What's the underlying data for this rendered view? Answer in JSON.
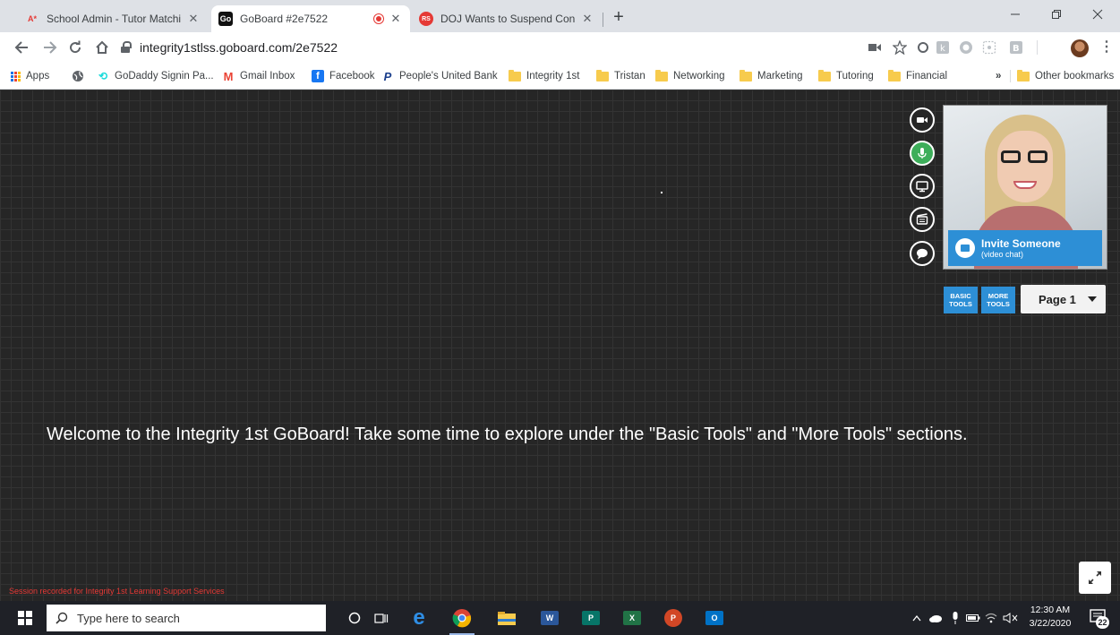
{
  "browser": {
    "tabs": [
      {
        "label": "School Admin - Tutor Matching S",
        "favicon": "A*",
        "close": "✕"
      },
      {
        "label": "GoBoard  #2e7522",
        "favicon": "Go",
        "close": "✕",
        "active": true
      },
      {
        "label": "DOJ Wants to Suspend Constituti",
        "favicon": "RS",
        "close": "✕"
      }
    ],
    "new_tab": "+",
    "url": "integrity1stlss.goboard.com/2e7522",
    "bookmarks": [
      {
        "label": "Apps",
        "type": "apps"
      },
      {
        "label": "",
        "type": "globe"
      },
      {
        "label": "GoDaddy Signin Pa...",
        "type": "site",
        "icon": "⟲"
      },
      {
        "label": "Gmail Inbox",
        "type": "site",
        "icon": "M"
      },
      {
        "label": "Facebook",
        "type": "site",
        "icon": "f"
      },
      {
        "label": "People's United Bank",
        "type": "site",
        "icon": "P"
      },
      {
        "label": "Integrity 1st",
        "type": "folder"
      },
      {
        "label": "Tristan",
        "type": "folder"
      },
      {
        "label": "Networking",
        "type": "folder"
      },
      {
        "label": "Marketing",
        "type": "folder"
      },
      {
        "label": "Tutoring",
        "type": "folder"
      },
      {
        "label": "Financial",
        "type": "folder"
      }
    ],
    "more_bookmarks": "»",
    "other_bookmarks": "Other bookmarks"
  },
  "board": {
    "invite_title": "Invite Someone",
    "invite_subtitle": "(video chat)",
    "basic_tools": [
      "BASIC",
      "TOOLS"
    ],
    "more_tools": [
      "MORE",
      "TOOLS"
    ],
    "page_selector": "Page 1",
    "welcome_text": "Welcome to the Integrity 1st GoBoard!  Take some time to explore under the \"Basic Tools\" and \"More Tools\" sections.",
    "session_text": "Session recorded for Integrity 1st Learning Support Services"
  },
  "taskbar": {
    "search_placeholder": "Type here to search",
    "time": "12:30 AM",
    "date": "3/22/2020",
    "notifications": "22"
  },
  "colors": {
    "accent_blue": "#2d8fd6",
    "mic_active": "#3dae5a",
    "board_bg": "#262626",
    "session_red": "#e53935"
  }
}
